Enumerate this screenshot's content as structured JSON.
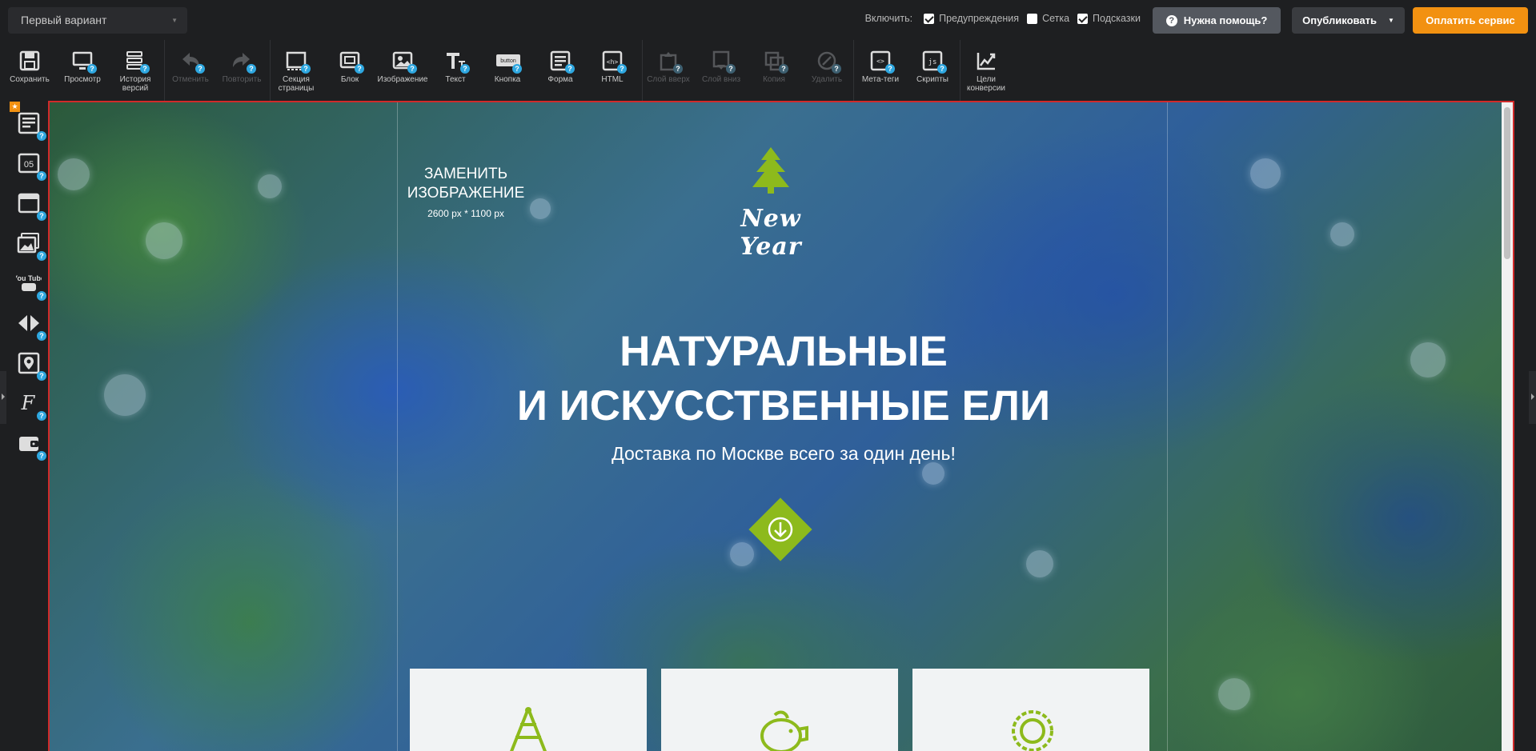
{
  "topbar": {
    "variant": "Первый вариант",
    "enable_label": "Включить:",
    "options": [
      {
        "label": "Предупреждения",
        "checked": true
      },
      {
        "label": "Сетка",
        "checked": false
      },
      {
        "label": "Подсказки",
        "checked": true
      }
    ],
    "help_label": "Нужна помощь?",
    "publish_label": "Опубликовать",
    "pay_label": "Оплатить сервис"
  },
  "toolbar": {
    "save": "Сохранить",
    "preview": "Просмотр",
    "history": "История версий",
    "undo": "Отменить",
    "redo": "Повторить",
    "section": "Секция страницы",
    "block": "Блок",
    "image": "Изображение",
    "text": "Текст",
    "button": "Кнопка",
    "button_icon_text": "button",
    "form": "Форма",
    "html": "HTML",
    "layer_up": "Слой вверх",
    "layer_down": "Слой вниз",
    "copy": "Копия",
    "delete": "Удалить",
    "meta": "Мета-теги",
    "scripts": "Скрипты",
    "goals": "Цели конверсии"
  },
  "sidebar": {
    "timer_text": "05",
    "youtube_text": "You Tube"
  },
  "canvas": {
    "replace_title": "ЗАМЕНИТЬ ИЗОБРАЖЕНИЕ",
    "replace_size": "2600 px * 1100 px",
    "logo_text": "New Year",
    "headline_1": "НАТУРАЛЬНЫЕ",
    "headline_2": "И ИСКУССТВЕННЫЕ ЕЛИ",
    "subtitle": "Доставка по Москве всего за один день!"
  },
  "colors": {
    "accent_green": "#8dba1c",
    "pay_orange": "#f29111",
    "badge_blue": "#2ea7e0",
    "frame_red": "#d12a2a"
  }
}
